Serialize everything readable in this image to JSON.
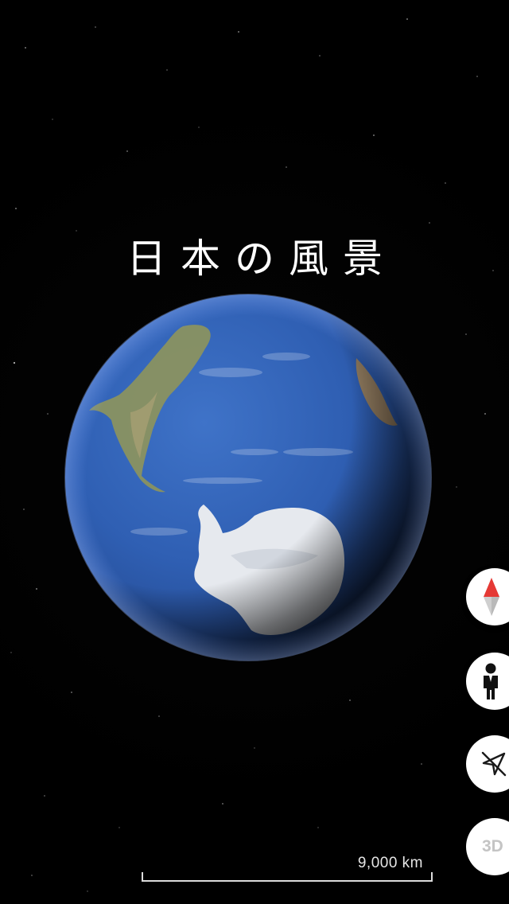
{
  "title": "日本の風景",
  "controls": {
    "compass_icon": "compass-icon",
    "pegman_icon": "pegman-icon",
    "location_icon": "location-off-icon",
    "mode_3d_label": "3D"
  },
  "scale": {
    "label": "9,000 km"
  },
  "colors": {
    "ocean": "#2f5fb3",
    "ice": "#e6e9ee",
    "land": "#8a9260",
    "compass_red": "#e53935",
    "background": "#000000"
  }
}
